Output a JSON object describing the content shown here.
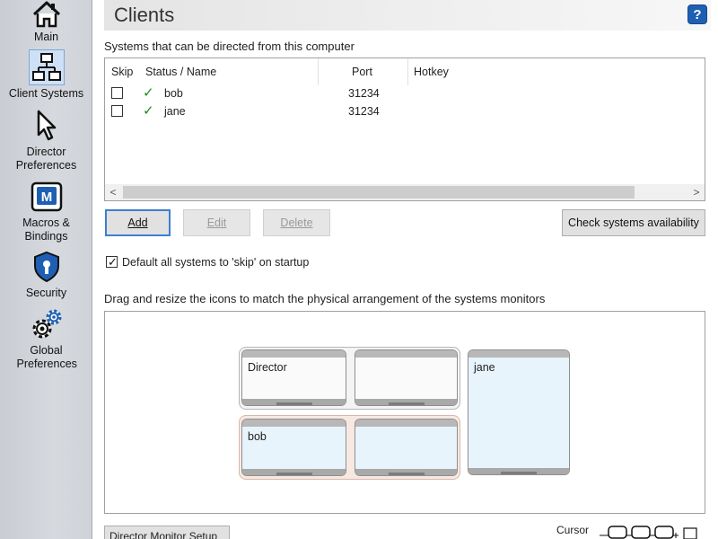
{
  "sidebar": {
    "items": [
      {
        "label": "Main",
        "icon": "home-icon"
      },
      {
        "label": "Client Systems",
        "icon": "network-icon",
        "active": true
      },
      {
        "label": "Director Preferences",
        "icon": "cursor-icon"
      },
      {
        "label": "Macros & Bindings",
        "icon": "macro-icon"
      },
      {
        "label": "Security",
        "icon": "shield-lock-icon"
      },
      {
        "label": "Global Preferences",
        "icon": "gears-icon"
      }
    ]
  },
  "header": {
    "title": "Clients",
    "help_label": "?"
  },
  "systems": {
    "section_label": "Systems that can be directed from this computer",
    "columns": [
      "Skip",
      "Status / Name",
      "Port",
      "Hotkey"
    ],
    "rows": [
      {
        "skip": false,
        "status": "✓",
        "name": "bob",
        "port": "31234",
        "hotkey": ""
      },
      {
        "skip": false,
        "status": "✓",
        "name": "jane",
        "port": "31234",
        "hotkey": ""
      }
    ],
    "scroll_left": "<",
    "scroll_right": ">"
  },
  "buttons": {
    "add": "Add",
    "edit": "Edit",
    "delete": "Delete",
    "check": "Check systems availability"
  },
  "skip_default": {
    "label": "Default all systems to 'skip' on startup",
    "checked": true
  },
  "arrangement": {
    "section_label": "Drag and resize the icons to match the physical arrangement of the systems monitors",
    "monitors": [
      {
        "label": "Director"
      },
      {
        "label": ""
      },
      {
        "label": "jane"
      },
      {
        "label": "bob"
      },
      {
        "label": ""
      }
    ]
  },
  "footer": {
    "director_monitor_setup": "Director Monitor Setup",
    "cursor_label": "Cursor"
  },
  "colors": {
    "accent": "#3c7fd0",
    "status_ok": "#1d8a1d",
    "help_blue": "#1e5fb4"
  }
}
